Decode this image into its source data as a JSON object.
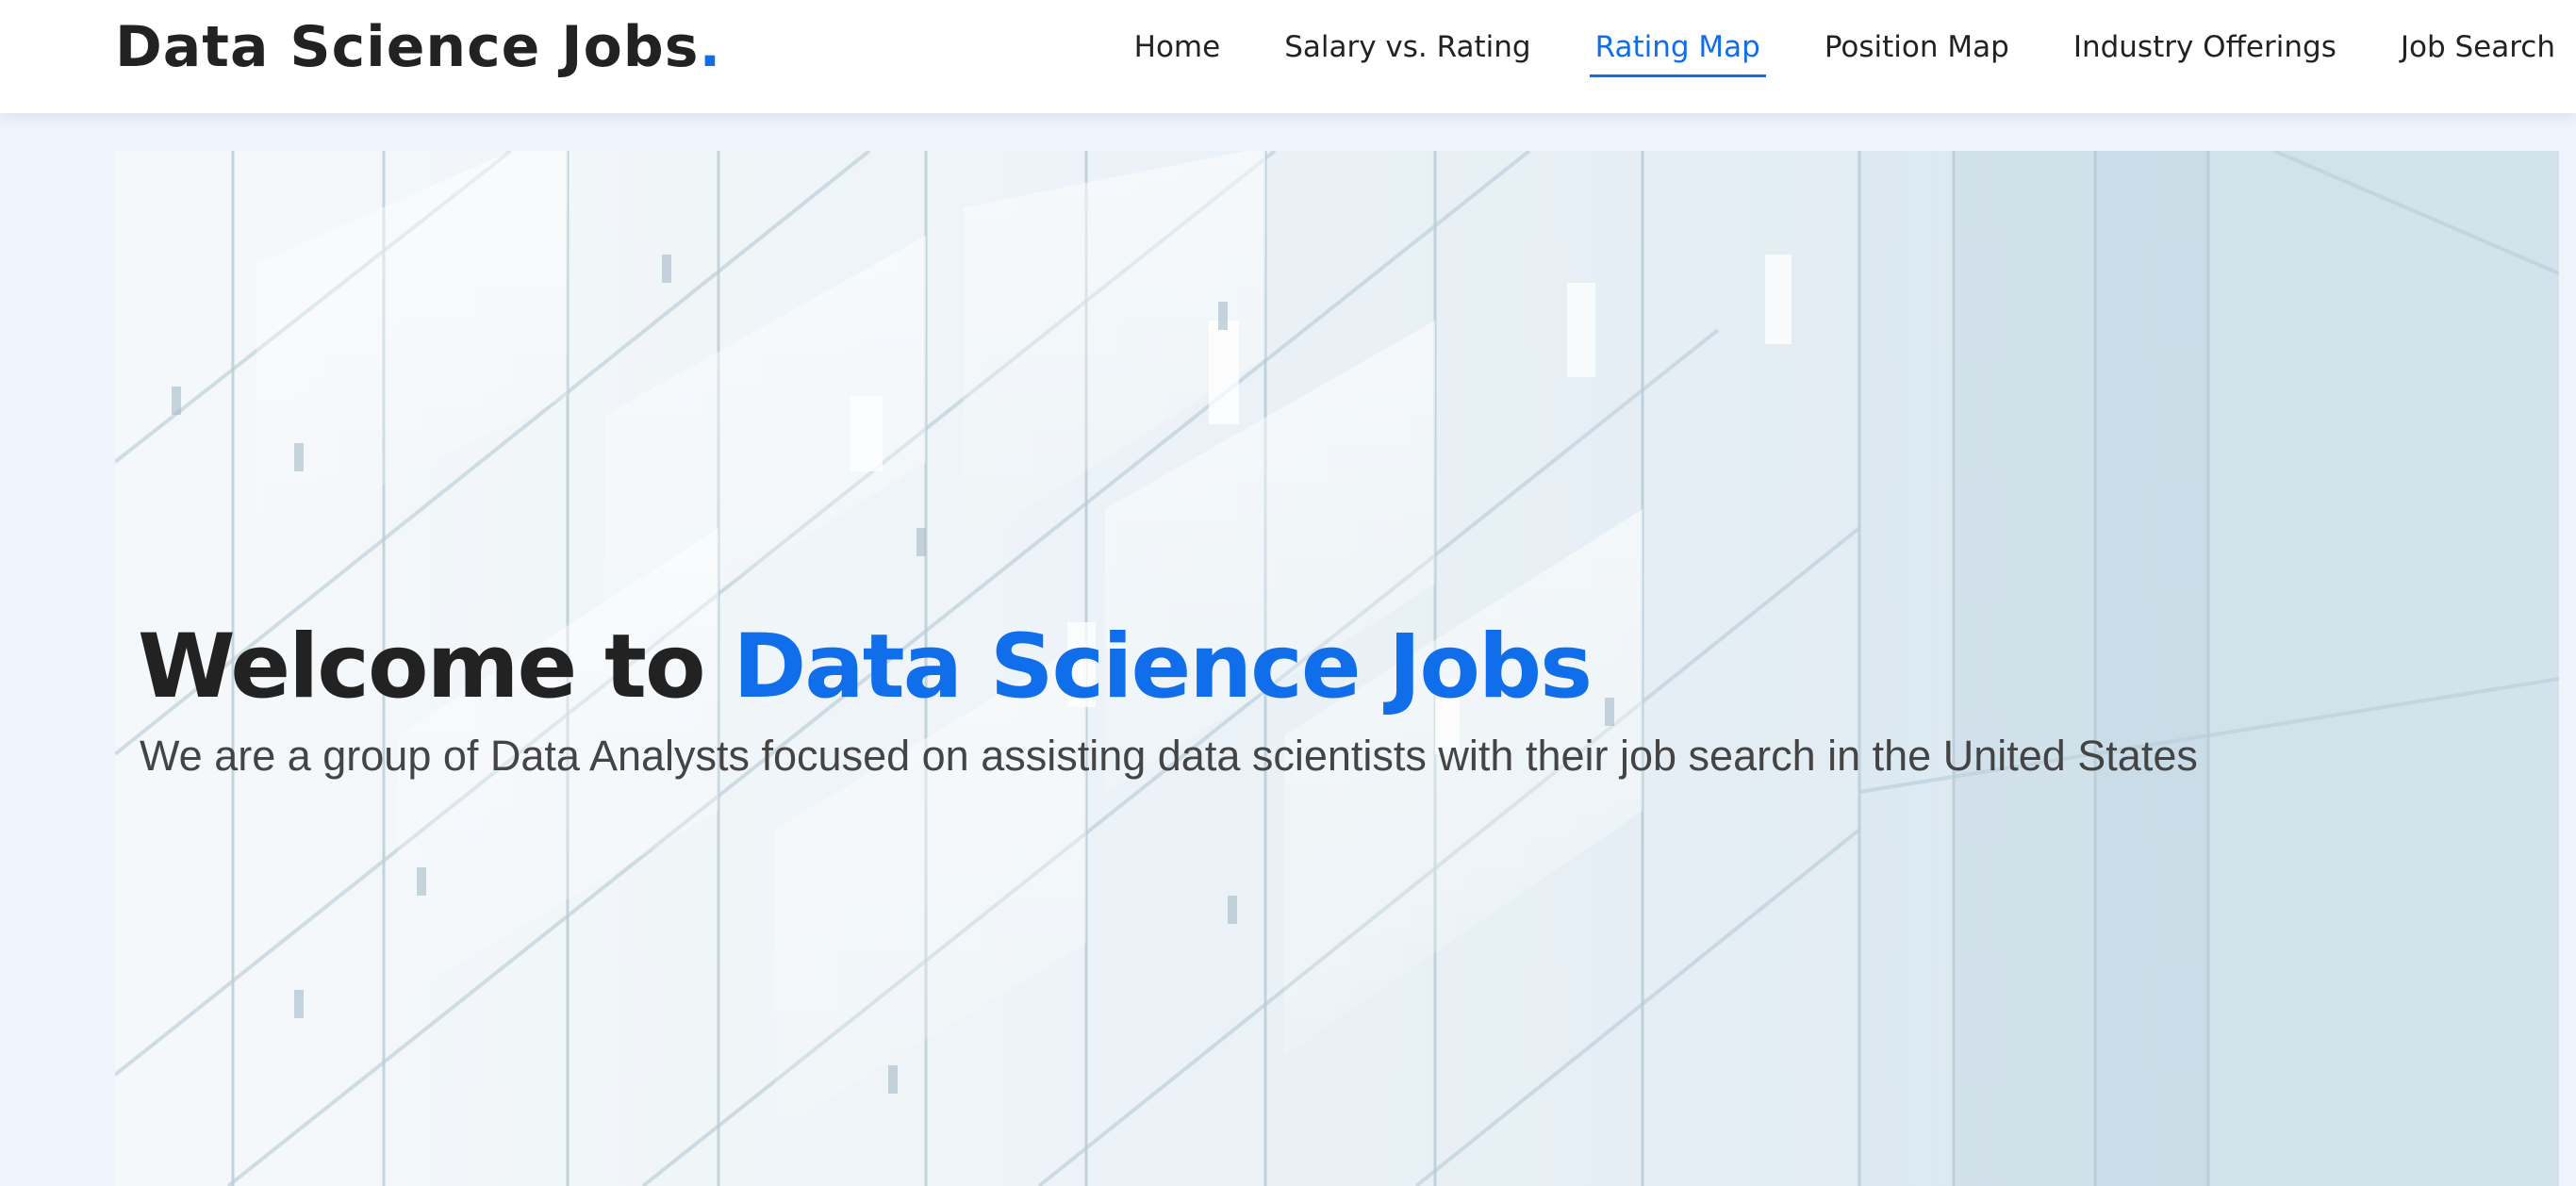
{
  "header": {
    "logo_text": "Data Science Jobs",
    "logo_dot": "."
  },
  "nav": {
    "items": [
      {
        "label": "Home"
      },
      {
        "label": "Salary vs. Rating"
      },
      {
        "label": "Rating Map",
        "active": true
      },
      {
        "label": "Position Map"
      },
      {
        "label": "Industry Offerings"
      },
      {
        "label": "Job Search"
      }
    ]
  },
  "hero": {
    "title_prefix": "Welcome to ",
    "title_highlight": "Data Science Jobs",
    "subtitle": "We are a group of Data Analysts focused on assisting data scientists with their job search in the United States"
  },
  "colors": {
    "accent": "#106eea",
    "text_dark": "#222222",
    "text_muted": "#444444",
    "page_background": "#eef4fc"
  }
}
